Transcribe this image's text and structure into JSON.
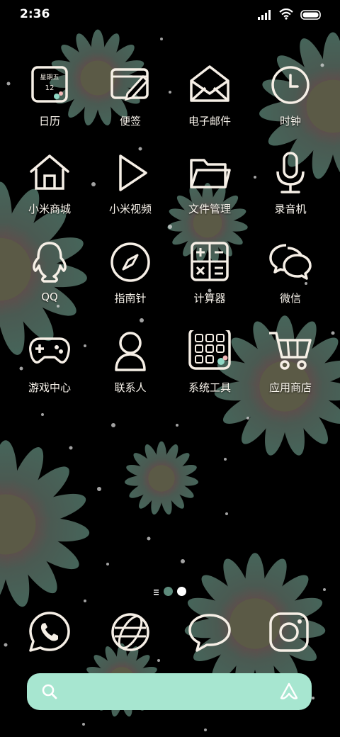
{
  "status_bar": {
    "time": "2:36",
    "icons": [
      "signal-icon",
      "wifi-icon",
      "battery-icon"
    ]
  },
  "calendar_icon": {
    "weekday": "星期五",
    "date": "12"
  },
  "apps": [
    {
      "label": "日历",
      "icon": "calendar-icon"
    },
    {
      "label": "便签",
      "icon": "notes-icon"
    },
    {
      "label": "电子邮件",
      "icon": "email-icon"
    },
    {
      "label": "时钟",
      "icon": "clock-icon"
    },
    {
      "label": "小米商城",
      "icon": "store-house-icon"
    },
    {
      "label": "小米视频",
      "icon": "play-icon"
    },
    {
      "label": "文件管理",
      "icon": "folder-icon"
    },
    {
      "label": "录音机",
      "icon": "microphone-icon"
    },
    {
      "label": "QQ",
      "icon": "qq-penguin-icon"
    },
    {
      "label": "指南针",
      "icon": "compass-icon"
    },
    {
      "label": "计算器",
      "icon": "calculator-icon"
    },
    {
      "label": "微信",
      "icon": "wechat-icon"
    },
    {
      "label": "游戏中心",
      "icon": "gamepad-icon"
    },
    {
      "label": "联系人",
      "icon": "contacts-icon"
    },
    {
      "label": "系统工具",
      "icon": "tools-folder-icon"
    },
    {
      "label": "应用商店",
      "icon": "cart-icon"
    }
  ],
  "page_indicator": {
    "pages": 2,
    "current": 2
  },
  "dock": [
    "whatsapp-icon",
    "browser-globe-icon",
    "messages-icon",
    "instagram-icon"
  ],
  "search": {
    "placeholder": ""
  },
  "colors": {
    "icon_stroke": "#f6efe6",
    "search_bar": "#a7e6d0",
    "petal_green": "#3f5a50",
    "petal_rose": "#6a4446",
    "flower_center": "#5b5a46"
  }
}
